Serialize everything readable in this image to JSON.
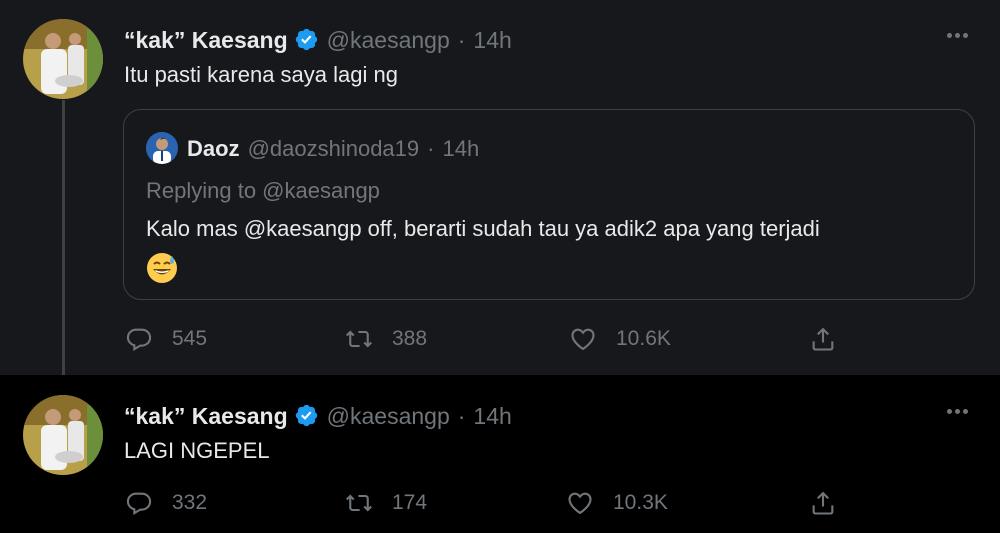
{
  "tweets": [
    {
      "author_name": "“kak” Kaesang",
      "handle": "@kaesangp",
      "separator": "·",
      "time": "14h",
      "text": "Itu pasti karena saya lagi ng",
      "quote": {
        "author_name": "Daoz",
        "handle": "@daozshinoda19",
        "separator": "·",
        "time": "14h",
        "replying_to": "Replying to @kaesangp",
        "text": "Kalo mas @kaesangp  off, berarti sudah tau ya adik2 apa yang terjadi",
        "emoji": "grinning-sweat-emoji"
      },
      "stats": {
        "replies": "545",
        "retweets": "388",
        "likes": "10.6K"
      }
    },
    {
      "author_name": "“kak” Kaesang",
      "handle": "@kaesangp",
      "separator": "·",
      "time": "14h",
      "text": "LAGI NGEPEL",
      "stats": {
        "replies": "332",
        "retweets": "174",
        "likes": "10.3K"
      }
    }
  ],
  "icons": [
    "verified-badge-icon",
    "more-options-icon",
    "reply-icon",
    "retweet-icon",
    "like-icon",
    "share-icon"
  ],
  "colors": {
    "background_first": "#16181c",
    "background_second": "#000000",
    "verified": "#1d9bf0",
    "muted": "#71767b",
    "text": "#e7e9ea"
  }
}
